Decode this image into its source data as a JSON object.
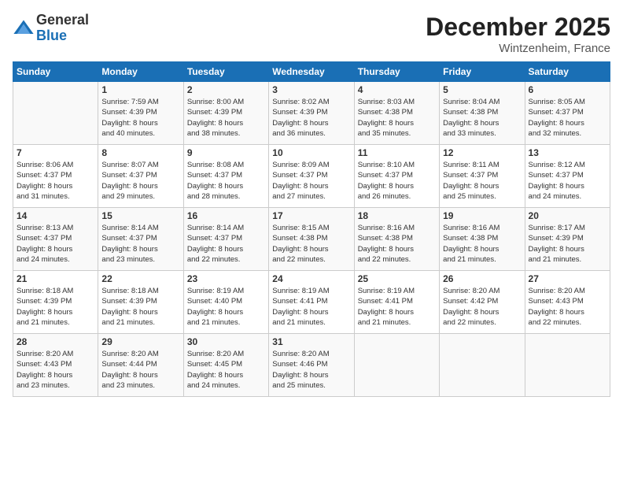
{
  "logo": {
    "general": "General",
    "blue": "Blue"
  },
  "header": {
    "month": "December 2025",
    "location": "Wintzenheim, France"
  },
  "weekdays": [
    "Sunday",
    "Monday",
    "Tuesday",
    "Wednesday",
    "Thursday",
    "Friday",
    "Saturday"
  ],
  "weeks": [
    [
      {
        "day": "",
        "info": ""
      },
      {
        "day": "1",
        "info": "Sunrise: 7:59 AM\nSunset: 4:39 PM\nDaylight: 8 hours\nand 40 minutes."
      },
      {
        "day": "2",
        "info": "Sunrise: 8:00 AM\nSunset: 4:39 PM\nDaylight: 8 hours\nand 38 minutes."
      },
      {
        "day": "3",
        "info": "Sunrise: 8:02 AM\nSunset: 4:39 PM\nDaylight: 8 hours\nand 36 minutes."
      },
      {
        "day": "4",
        "info": "Sunrise: 8:03 AM\nSunset: 4:38 PM\nDaylight: 8 hours\nand 35 minutes."
      },
      {
        "day": "5",
        "info": "Sunrise: 8:04 AM\nSunset: 4:38 PM\nDaylight: 8 hours\nand 33 minutes."
      },
      {
        "day": "6",
        "info": "Sunrise: 8:05 AM\nSunset: 4:37 PM\nDaylight: 8 hours\nand 32 minutes."
      }
    ],
    [
      {
        "day": "7",
        "info": "Sunrise: 8:06 AM\nSunset: 4:37 PM\nDaylight: 8 hours\nand 31 minutes."
      },
      {
        "day": "8",
        "info": "Sunrise: 8:07 AM\nSunset: 4:37 PM\nDaylight: 8 hours\nand 29 minutes."
      },
      {
        "day": "9",
        "info": "Sunrise: 8:08 AM\nSunset: 4:37 PM\nDaylight: 8 hours\nand 28 minutes."
      },
      {
        "day": "10",
        "info": "Sunrise: 8:09 AM\nSunset: 4:37 PM\nDaylight: 8 hours\nand 27 minutes."
      },
      {
        "day": "11",
        "info": "Sunrise: 8:10 AM\nSunset: 4:37 PM\nDaylight: 8 hours\nand 26 minutes."
      },
      {
        "day": "12",
        "info": "Sunrise: 8:11 AM\nSunset: 4:37 PM\nDaylight: 8 hours\nand 25 minutes."
      },
      {
        "day": "13",
        "info": "Sunrise: 8:12 AM\nSunset: 4:37 PM\nDaylight: 8 hours\nand 24 minutes."
      }
    ],
    [
      {
        "day": "14",
        "info": "Sunrise: 8:13 AM\nSunset: 4:37 PM\nDaylight: 8 hours\nand 24 minutes."
      },
      {
        "day": "15",
        "info": "Sunrise: 8:14 AM\nSunset: 4:37 PM\nDaylight: 8 hours\nand 23 minutes."
      },
      {
        "day": "16",
        "info": "Sunrise: 8:14 AM\nSunset: 4:37 PM\nDaylight: 8 hours\nand 22 minutes."
      },
      {
        "day": "17",
        "info": "Sunrise: 8:15 AM\nSunset: 4:38 PM\nDaylight: 8 hours\nand 22 minutes."
      },
      {
        "day": "18",
        "info": "Sunrise: 8:16 AM\nSunset: 4:38 PM\nDaylight: 8 hours\nand 22 minutes."
      },
      {
        "day": "19",
        "info": "Sunrise: 8:16 AM\nSunset: 4:38 PM\nDaylight: 8 hours\nand 21 minutes."
      },
      {
        "day": "20",
        "info": "Sunrise: 8:17 AM\nSunset: 4:39 PM\nDaylight: 8 hours\nand 21 minutes."
      }
    ],
    [
      {
        "day": "21",
        "info": "Sunrise: 8:18 AM\nSunset: 4:39 PM\nDaylight: 8 hours\nand 21 minutes."
      },
      {
        "day": "22",
        "info": "Sunrise: 8:18 AM\nSunset: 4:39 PM\nDaylight: 8 hours\nand 21 minutes."
      },
      {
        "day": "23",
        "info": "Sunrise: 8:19 AM\nSunset: 4:40 PM\nDaylight: 8 hours\nand 21 minutes."
      },
      {
        "day": "24",
        "info": "Sunrise: 8:19 AM\nSunset: 4:41 PM\nDaylight: 8 hours\nand 21 minutes."
      },
      {
        "day": "25",
        "info": "Sunrise: 8:19 AM\nSunset: 4:41 PM\nDaylight: 8 hours\nand 21 minutes."
      },
      {
        "day": "26",
        "info": "Sunrise: 8:20 AM\nSunset: 4:42 PM\nDaylight: 8 hours\nand 22 minutes."
      },
      {
        "day": "27",
        "info": "Sunrise: 8:20 AM\nSunset: 4:43 PM\nDaylight: 8 hours\nand 22 minutes."
      }
    ],
    [
      {
        "day": "28",
        "info": "Sunrise: 8:20 AM\nSunset: 4:43 PM\nDaylight: 8 hours\nand 23 minutes."
      },
      {
        "day": "29",
        "info": "Sunrise: 8:20 AM\nSunset: 4:44 PM\nDaylight: 8 hours\nand 23 minutes."
      },
      {
        "day": "30",
        "info": "Sunrise: 8:20 AM\nSunset: 4:45 PM\nDaylight: 8 hours\nand 24 minutes."
      },
      {
        "day": "31",
        "info": "Sunrise: 8:20 AM\nSunset: 4:46 PM\nDaylight: 8 hours\nand 25 minutes."
      },
      {
        "day": "",
        "info": ""
      },
      {
        "day": "",
        "info": ""
      },
      {
        "day": "",
        "info": ""
      }
    ]
  ]
}
